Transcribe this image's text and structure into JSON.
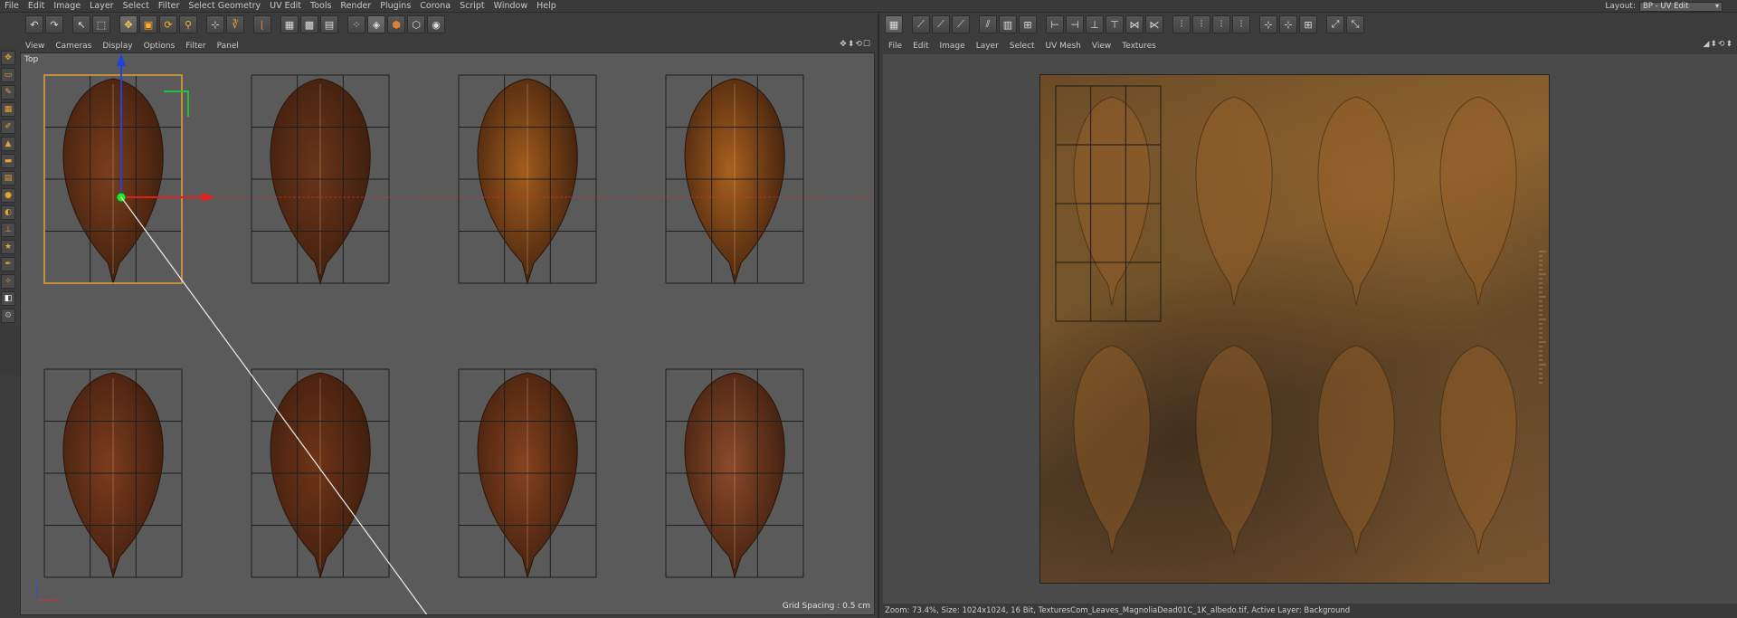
{
  "menubar": {
    "items": [
      "File",
      "Edit",
      "Image",
      "Layer",
      "Select",
      "Filter",
      "Select Geometry",
      "UV Edit",
      "Tools",
      "Render",
      "Plugins",
      "Corona",
      "Script",
      "Window",
      "Help"
    ],
    "layout_label": "Layout:",
    "layout_value": "BP - UV Edit"
  },
  "viewport": {
    "menu": [
      "View",
      "Cameras",
      "Display",
      "Options",
      "Filter",
      "Panel"
    ],
    "nav_icons": "✥⬍⟲☐",
    "label": "Top",
    "grid_spacing": "Grid Spacing : 0.5 cm",
    "axis_x": "x",
    "axis_z": "z"
  },
  "uv": {
    "menu": [
      "File",
      "Edit",
      "Image",
      "Layer",
      "Select",
      "UV Mesh",
      "View",
      "Textures"
    ],
    "nav_icons": "◢⬍⟲⬍",
    "status": "Zoom: 73.4%, Size: 1024x1024, 16 Bit, TexturesCom_Leaves_MagnoliaDead01C_1K_albedo.tif, Active Layer: Background"
  },
  "leaves": [
    {
      "color": "#7a3e1c"
    },
    {
      "color": "#6a351a"
    },
    {
      "color": "#a15c1c"
    },
    {
      "color": "#a8601e"
    },
    {
      "color": "#7c3c1e"
    },
    {
      "color": "#6e3418"
    },
    {
      "color": "#85421f"
    },
    {
      "color": "#8a4a2a"
    }
  ]
}
